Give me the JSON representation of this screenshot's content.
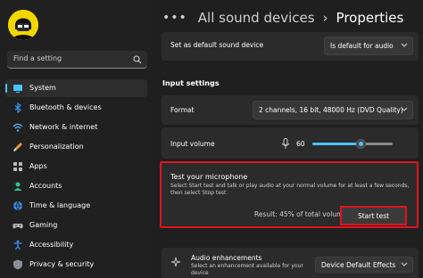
{
  "sidebar": {
    "search_placeholder": "Find a setting",
    "items": [
      {
        "label": "System",
        "icon": "monitor-icon",
        "active": true
      },
      {
        "label": "Bluetooth & devices",
        "icon": "bluetooth-icon"
      },
      {
        "label": "Network & internet",
        "icon": "wifi-icon"
      },
      {
        "label": "Personalization",
        "icon": "brush-icon"
      },
      {
        "label": "Apps",
        "icon": "apps-icon"
      },
      {
        "label": "Accounts",
        "icon": "person-icon"
      },
      {
        "label": "Time & language",
        "icon": "globe-icon"
      },
      {
        "label": "Gaming",
        "icon": "gamepad-icon"
      },
      {
        "label": "Accessibility",
        "icon": "accessibility-icon"
      },
      {
        "label": "Privacy & security",
        "icon": "shield-icon"
      }
    ]
  },
  "header": {
    "dots": "•••",
    "crumb_1": "All sound devices",
    "separator": "›",
    "crumb_2": "Properties"
  },
  "default_device": {
    "label": "Set as default sound device",
    "dropdown_value": "Is default for audio"
  },
  "input_settings": {
    "title": "Input settings",
    "format_label": "Format",
    "format_value": "2 channels, 16 bit, 48000 Hz (DVD Quality)",
    "volume_label": "Input volume",
    "volume_value": "60",
    "volume_level": 0.6
  },
  "test": {
    "title": "Test your microphone",
    "description_1": "Select Start test and talk or play audio at your normal volume for at least a few seconds,",
    "description_2": "then select Stop test",
    "result": "Result: 45% of total volume",
    "button_label": "Start test"
  },
  "enhancements": {
    "title": "Audio enhancements",
    "description_1": "Select an enhancement available for your",
    "description_2": "device",
    "dropdown_value": "Device Default Effects"
  },
  "colors": {
    "accent": "#4cc2ff",
    "highlight": "#e0141e"
  }
}
